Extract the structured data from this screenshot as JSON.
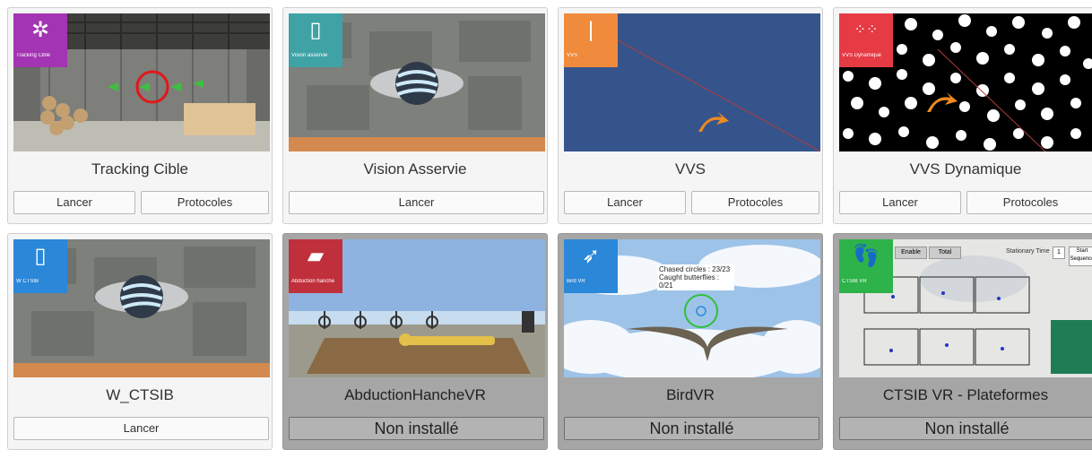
{
  "cards": [
    {
      "title": "Tracking Cible",
      "badge_text": "Tracking Cible",
      "badge_color": "#a334b3",
      "badge_icon": "target-bug-icon",
      "buttons": [
        "Lancer",
        "Protocoles"
      ],
      "installed": true
    },
    {
      "title": "Vision Asservie",
      "badge_text": "Vision asservie",
      "badge_color": "#3fa3a6",
      "badge_icon": "vr-headset-icon",
      "buttons": [
        "Lancer"
      ],
      "installed": true
    },
    {
      "title": "VVS",
      "badge_text": "VVS",
      "badge_color": "#f08a3c",
      "badge_icon": "vertical-line-icon",
      "buttons": [
        "Lancer",
        "Protocoles"
      ],
      "installed": true
    },
    {
      "title": "VVS Dynamique",
      "badge_text": "VVS Dynamique",
      "badge_color": "#e63a45",
      "badge_icon": "dots-grid-icon",
      "buttons": [
        "Lancer",
        "Protocoles"
      ],
      "installed": true
    },
    {
      "title": "W_CTSIB",
      "badge_text": "W CTSIB",
      "badge_color": "#2b87d8",
      "badge_icon": "vr-headset-icon",
      "buttons": [
        "Lancer"
      ],
      "installed": true
    },
    {
      "title": "AbductionHancheVR",
      "badge_text": "Abduction hanche",
      "badge_color": "#c0303c",
      "badge_icon": "leg-raise-icon",
      "buttons": [
        "Non installé"
      ],
      "installed": false
    },
    {
      "title": "BirdVR",
      "badge_text": "Bird VR",
      "badge_color": "#2b87d8",
      "badge_icon": "bird-icon",
      "buttons": [
        "Non installé"
      ],
      "installed": false,
      "overlay": [
        "Chased circles : 23/23",
        "Caught butterflies : 0/21"
      ]
    },
    {
      "title": "CTSIB VR - Plateformes",
      "badge_text": "CTSIB VR",
      "badge_color": "#2eb24a",
      "badge_icon": "feet-icon",
      "buttons": [
        "Non installé"
      ],
      "installed": false,
      "overlay": [
        "Enable",
        "Total",
        "Stationary Time",
        "1",
        "Start Sequence"
      ]
    }
  ]
}
